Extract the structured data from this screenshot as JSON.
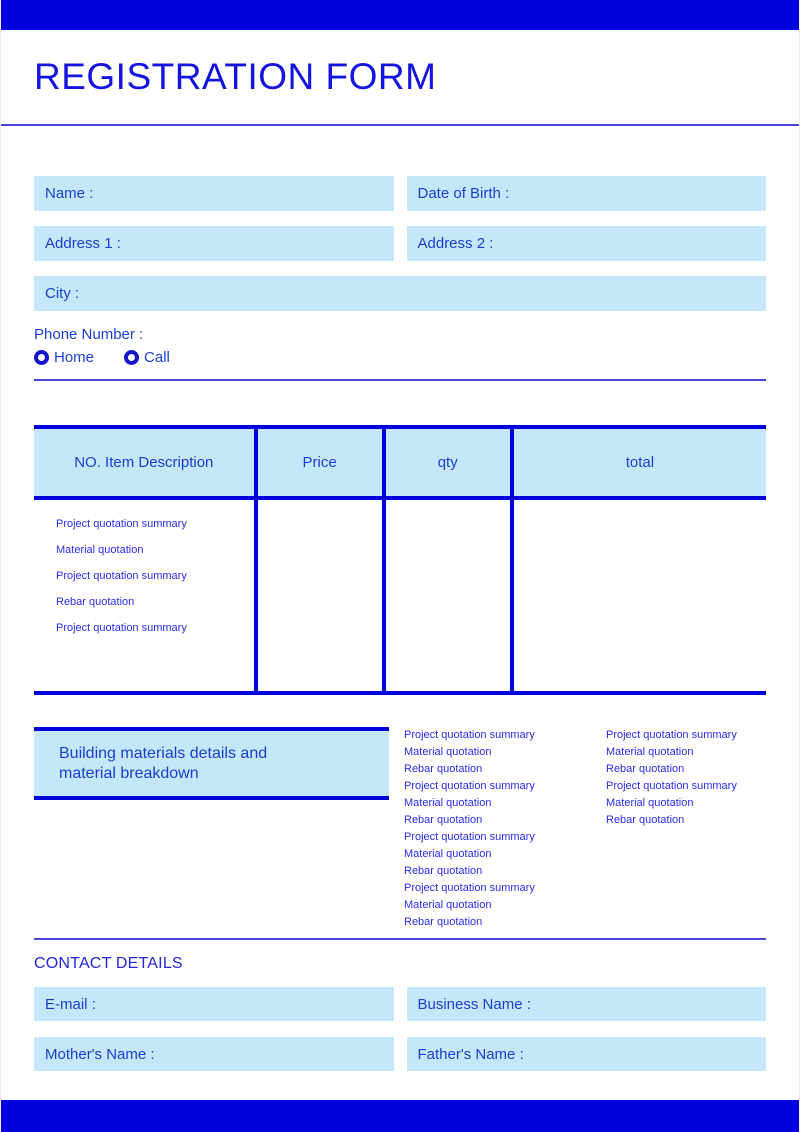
{
  "document": {
    "title": "REGISTRATION FORM"
  },
  "theme": {
    "accent": "#0000DD",
    "field_fill": "#C5E7FA",
    "text_blue": "#1A3FD0",
    "rule": "#4A44E0"
  },
  "personal": {
    "fields": [
      {
        "label": "Name :",
        "value": ""
      },
      {
        "label": "Date of Birth :",
        "value": ""
      },
      {
        "label": "Address 1 :",
        "value": ""
      },
      {
        "label": "Address 2 :",
        "value": ""
      },
      {
        "label": "City :",
        "value": ""
      }
    ],
    "phone_label": "Phone Number :",
    "phone_options": [
      {
        "label": "Home",
        "selected": false
      },
      {
        "label": "Call",
        "selected": false
      }
    ]
  },
  "items_table": {
    "headers": [
      "NO. Item Description",
      "Price",
      "qty",
      "total"
    ],
    "descriptions": [
      "Project quotation summary",
      "Material quotation",
      "Project quotation summary",
      "Rebar quotation",
      "Project quotation summary"
    ],
    "price_values": [],
    "qty_values": [],
    "total_values": []
  },
  "materials": {
    "heading": "Building materials details and\nmaterial breakdown",
    "column_left": [
      "Project quotation summary",
      "Material quotation",
      "Rebar quotation",
      "Project quotation summary",
      "Material quotation",
      "Rebar quotation",
      "Project quotation summary",
      "Material quotation",
      "Rebar quotation",
      "Project quotation summary",
      "Material quotation",
      "Rebar quotation"
    ],
    "column_right": [
      "Project quotation summary",
      "Material quotation",
      "Rebar quotation",
      "Project quotation summary",
      "Material quotation",
      "Rebar quotation"
    ]
  },
  "contact": {
    "section_title": "CONTACT DETAILS",
    "fields": [
      {
        "label": "E-mail :",
        "value": ""
      },
      {
        "label": "Business Name :",
        "value": ""
      },
      {
        "label": "Mother's Name :",
        "value": ""
      },
      {
        "label": "Father's Name :",
        "value": ""
      }
    ]
  }
}
